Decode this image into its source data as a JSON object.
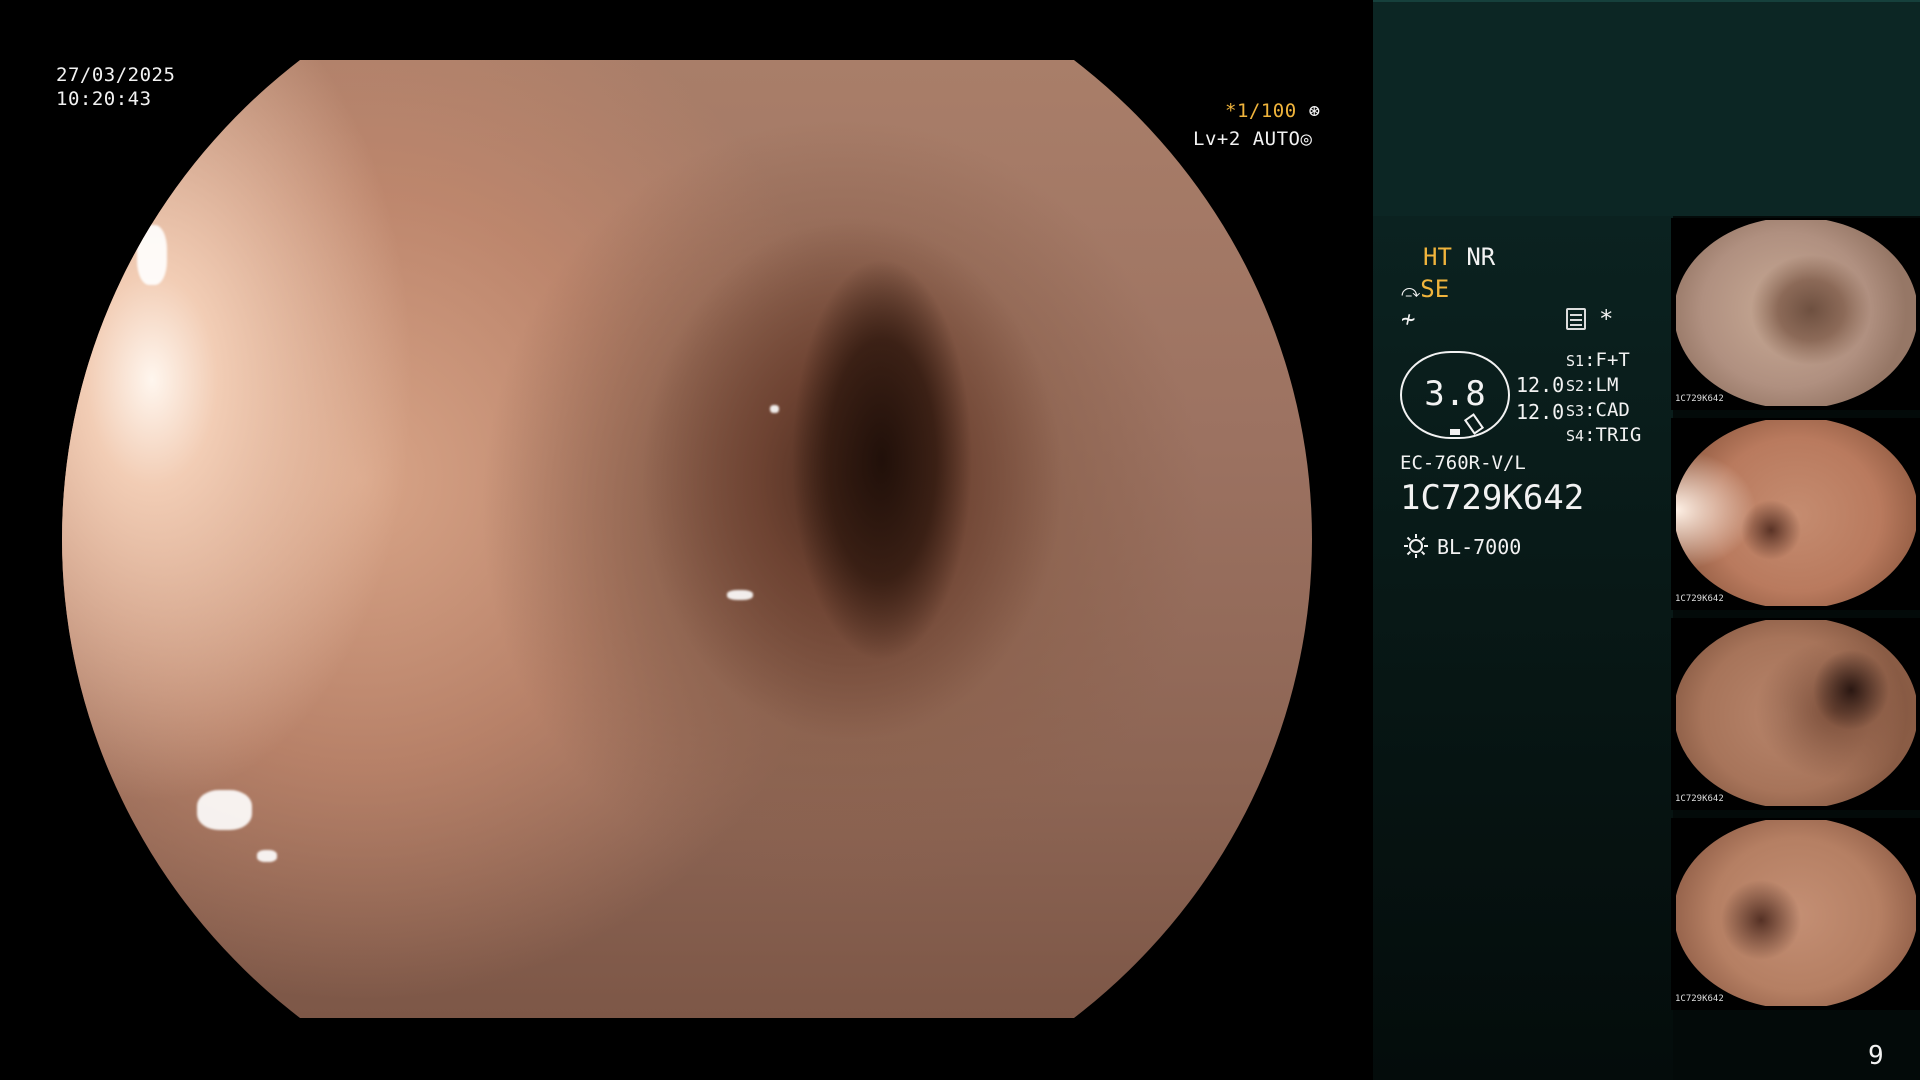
{
  "overlay": {
    "date": "27/03/2025",
    "time": "10:20:43",
    "shutter": "*1/100",
    "shutter_icon": "aperture-icon",
    "level": "Lv+2",
    "exposure_mode": "AUTO",
    "exposure_icon": "iris-icon"
  },
  "panel": {
    "ht": "HT",
    "nr": "NR",
    "se": "SE",
    "accent_color": "#f0b43c",
    "background_top": "#0c2624",
    "gauge_value": "3.8",
    "value_a": "12.0",
    "value_b": "12.0",
    "switches": [
      {
        "key": "S1",
        "value": "F+T"
      },
      {
        "key": "S2",
        "value": "LM"
      },
      {
        "key": "S3",
        "value": "CAD"
      },
      {
        "key": "S4",
        "value": "TRIG"
      }
    ],
    "asterisk": "*",
    "scope_model": "EC-760R-V/L",
    "serial": "1C729K642",
    "light_source": "BL-7000",
    "light_icon": "sun-icon"
  },
  "thumbnails": [
    {
      "id": "1C729K642"
    },
    {
      "id": "1C729K642"
    },
    {
      "id": "1C729K642"
    },
    {
      "id": "1C729K642"
    }
  ],
  "page_number": "9"
}
